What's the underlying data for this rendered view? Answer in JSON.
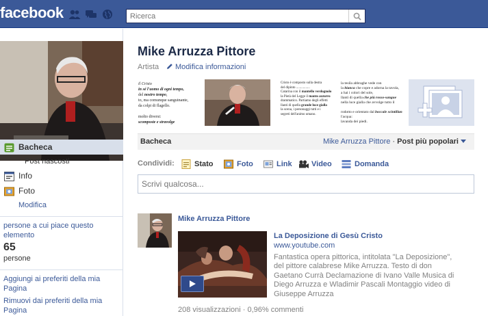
{
  "topbar": {
    "logo": "facebook",
    "search_placeholder": "Ricerca"
  },
  "sidebar": {
    "nav": [
      {
        "label": "Bacheca",
        "icon": "wall-icon",
        "selected": true
      },
      {
        "label": "Info",
        "icon": "info-icon"
      },
      {
        "label": "Foto",
        "icon": "photo-icon"
      }
    ],
    "sub_hidden_posts": "Post nascosti",
    "sub_modifica": "Modifica",
    "likes_title": "persone a cui piace questo elemento",
    "likes_count": "65",
    "likes_label": "persone",
    "fav_add": "Aggiungi ai preferiti della mia Pagina",
    "fav_remove": "Rimuovi dai preferiti della mia Pagina"
  },
  "page": {
    "title": "Mike Arruzza Pittore",
    "category": "Artista",
    "edit_info": "Modifica informazioni"
  },
  "wall": {
    "title": "Bacheca",
    "filter_name": "Mike Arruzza Pittore",
    "filter_sep": "·",
    "filter_popular": "Post più popolari"
  },
  "share": {
    "label": "Condividi:",
    "options": [
      "Stato",
      "Foto",
      "Link",
      "Video",
      "Domanda"
    ],
    "composer_placeholder": "Scrivi qualcosa..."
  },
  "story": {
    "author": "Mike Arruzza Pittore",
    "video_title": "La Deposizione di Gesù Cristo",
    "video_domain": "www.youtube.com",
    "video_desc": "Fantastica opera pittorica, intitolata \"La Deposizione\", del pittore calabrese Mike Arruzza. Testo di don Gaetano Currà Declamazione di Ivano Valle Musica di Diego Arruzza e Wladimir Pascali Montaggio video di Giuseppe Arruzza",
    "meta": "208 visualizzazioni · 0,96% commenti"
  },
  "colors": {
    "brand_blue": "#3b5998",
    "nav_selected": "#d8dfea"
  }
}
